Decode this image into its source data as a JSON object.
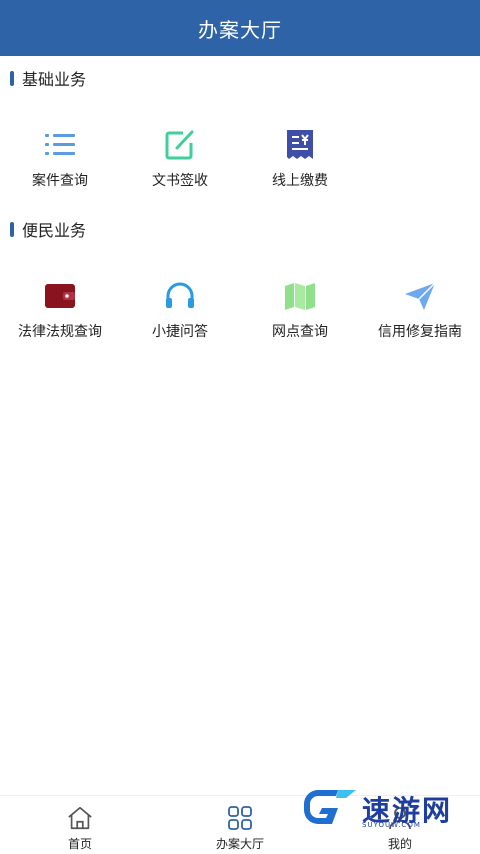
{
  "header": {
    "title": "办案大厅"
  },
  "sections": [
    {
      "title": "基础业务",
      "items": [
        {
          "label": "案件查询",
          "icon": "list-icon"
        },
        {
          "label": "文书签收",
          "icon": "edit-icon"
        },
        {
          "label": "线上缴费",
          "icon": "receipt-icon"
        }
      ]
    },
    {
      "title": "便民业务",
      "items": [
        {
          "label": "法律法规查询",
          "icon": "wallet-icon"
        },
        {
          "label": "小捷问答",
          "icon": "headphones-icon"
        },
        {
          "label": "网点查询",
          "icon": "map-icon"
        },
        {
          "label": "信用修复指南",
          "icon": "paper-plane-icon"
        }
      ]
    }
  ],
  "tabbar": {
    "items": [
      {
        "label": "首页",
        "icon": "home-icon"
      },
      {
        "label": "办案大厅",
        "icon": "grid-icon"
      },
      {
        "label": "我的",
        "icon": "user-icon"
      }
    ]
  },
  "watermark": {
    "text": "速游网",
    "sub": "SUYOUW.COM"
  },
  "colors": {
    "header": "#2e63a8",
    "list": "#5b9be0",
    "edit": "#3ecf9a",
    "receipt": "#3f4fa8",
    "wallet": "#8a1320",
    "headphones": "#2a9be0",
    "map": "#8fe08a",
    "plane": "#6ea8f0"
  }
}
